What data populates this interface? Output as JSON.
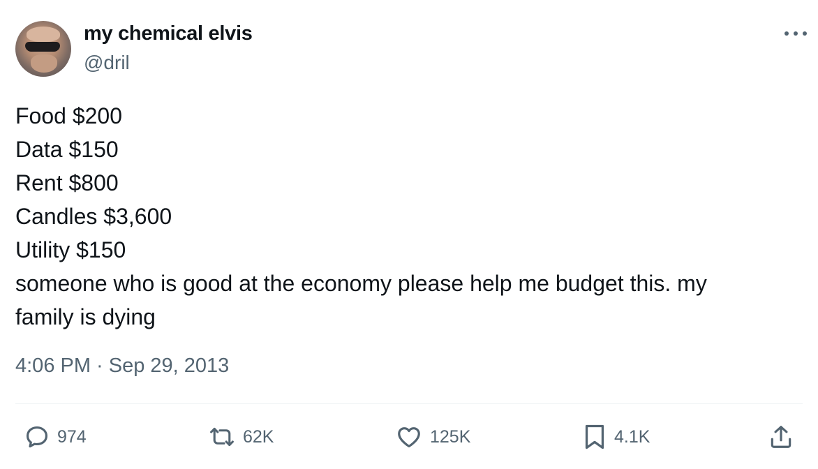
{
  "author": {
    "display_name": "my chemical elvis",
    "handle": "@dril"
  },
  "tweet": {
    "lines": [
      "Food $200",
      "Data $150",
      "Rent $800",
      "Candles $3,600",
      "Utility $150",
      "someone who is good at the economy please help me budget this. my",
      "family is dying"
    ],
    "timestamp": "4:06 PM · Sep 29, 2013"
  },
  "actions": {
    "replies": "974",
    "reposts": "62K",
    "likes": "125K",
    "bookmarks": "4.1K"
  },
  "icons": {
    "more": "more-dots-icon",
    "reply": "reply-bubble-icon",
    "repost": "repost-arrows-icon",
    "like": "heart-icon",
    "bookmark": "bookmark-icon",
    "share": "share-upload-icon"
  },
  "colors": {
    "text": "#0f1419",
    "secondary": "#536471",
    "divider": "#eff3f4"
  }
}
